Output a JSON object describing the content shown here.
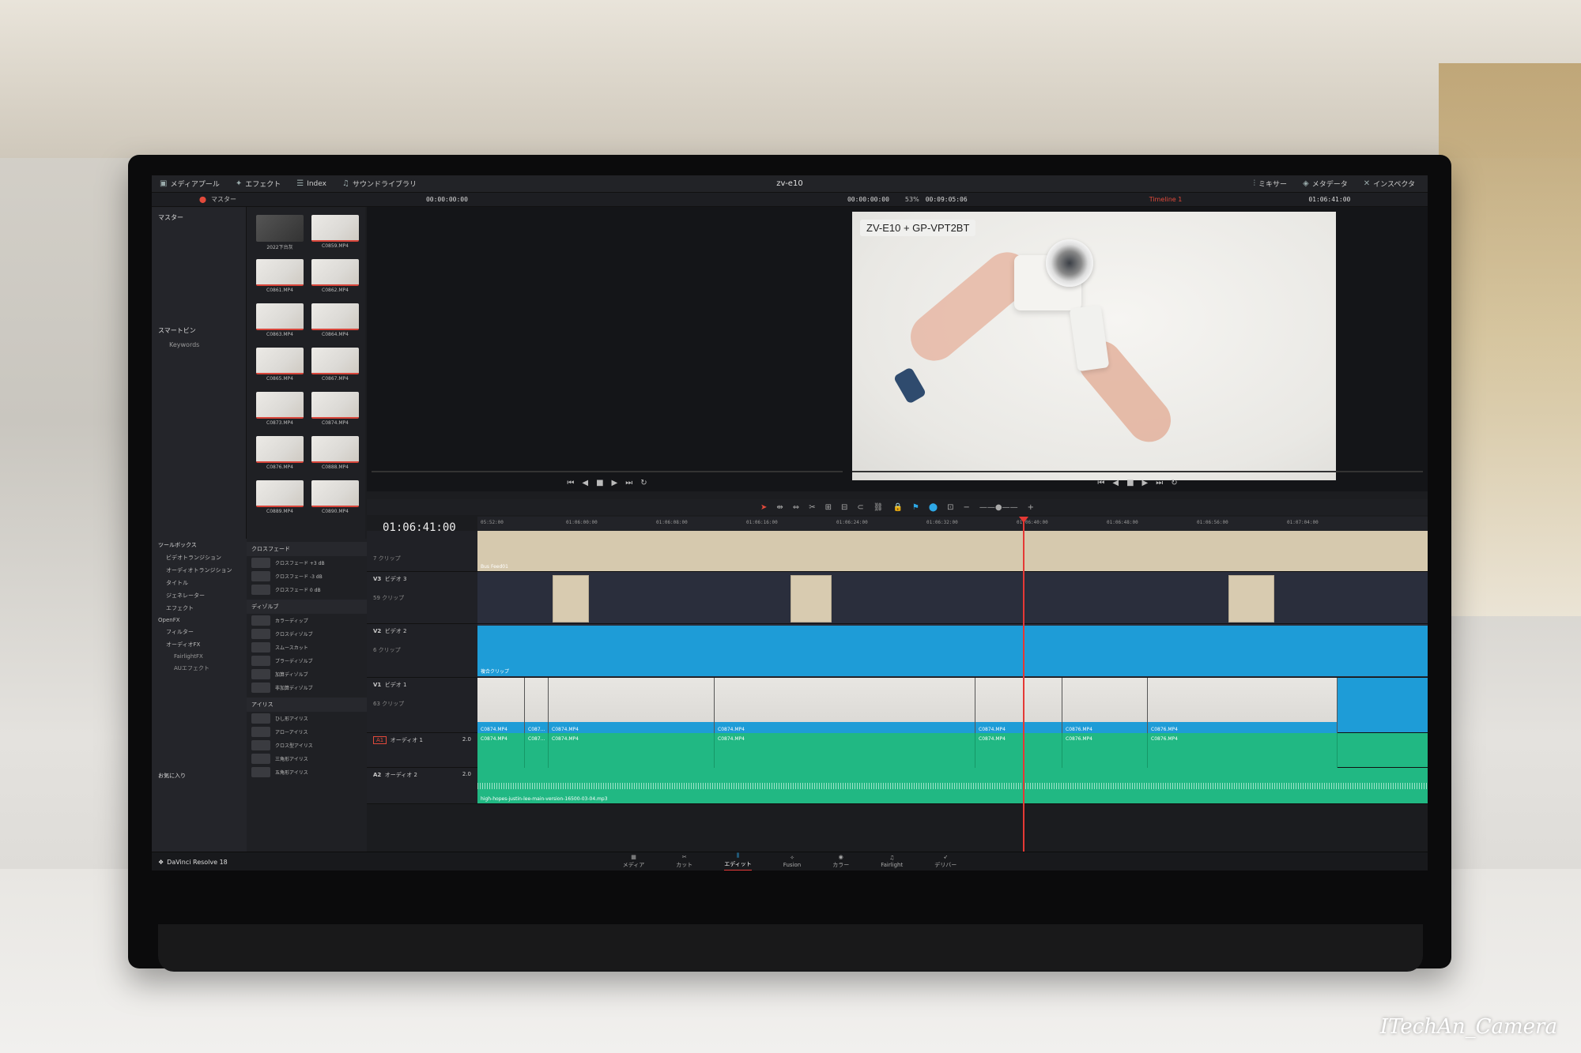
{
  "topbar": {
    "items": [
      {
        "icon": "media-pool-icon",
        "label": "メディアプール"
      },
      {
        "icon": "effects-icon",
        "label": "エフェクト"
      },
      {
        "icon": "index-icon",
        "label": "Index"
      },
      {
        "icon": "sound-library-icon",
        "label": "サウンドライブラリ"
      }
    ],
    "project_title": "zv-e10",
    "right_items": [
      {
        "icon": "mixer-icon",
        "label": "ミキサー"
      },
      {
        "icon": "metadata-icon",
        "label": "メタデータ"
      },
      {
        "icon": "inspector-icon",
        "label": "インスペクタ"
      }
    ]
  },
  "subbar": {
    "bin_label": "マスター",
    "source_tc": "00:00:00:00",
    "source_tc2": "00:00:00:00",
    "zoom": "53%",
    "duration": "00:09:05:06",
    "timeline_name": "Timeline 1",
    "record_tc": "01:06:41:00"
  },
  "pool_tree": {
    "master": "マスター",
    "smart_bin": "スマートビン",
    "keywords": "Keywords"
  },
  "pool_clips": [
    "2022下台灰",
    "C0859.MP4",
    "C0861.MP4",
    "C0862.MP4",
    "C0863.MP4",
    "C0864.MP4",
    "C0865.MP4",
    "C0867.MP4",
    "C0873.MP4",
    "C0874.MP4",
    "C0876.MP4",
    "C0888.MP4",
    "C0889.MP4",
    "C0890.MP4"
  ],
  "record_overlay": "ZV-E10 + GP-VPT2BT",
  "toolbox": {
    "root": "ツールボックス",
    "items": [
      "ビデオトランジション",
      "オーディオトランジション",
      "タイトル",
      "ジェネレーター",
      "エフェクト",
      "OpenFX",
      "フィルター",
      "オーディオFX",
      "FairlightFX",
      "AUエフェクト"
    ],
    "favorites": "お気に入り"
  },
  "effects_list": {
    "crossfade_head": "クロスフェード",
    "crossfades": [
      "クロスフェード +3 dB",
      "クロスフェード -3 dB",
      "クロスフェード 0 dB"
    ],
    "dissolve_head": "ディゾルブ",
    "dissolves": [
      "カラーディップ",
      "クロスディゾルブ",
      "スムースカット",
      "ブラーディゾルブ",
      "加算ディゾルブ",
      "非加算ディゾルブ"
    ],
    "iris_head": "アイリス",
    "irises": [
      "ひし形アイリス",
      "アローアイリス",
      "クロス型アイリス",
      "三角形アイリス",
      "五角形アイリス"
    ]
  },
  "timeline": {
    "timecode": "01:06:41:00",
    "ruler": [
      "05:52:00",
      "01:06:00:00",
      "01:06:08:00",
      "01:06:16:00",
      "01:06:24:00",
      "01:06:32:00",
      "01:06:40:00",
      "01:06:48:00",
      "01:06:56:00",
      "01:07:04:00"
    ],
    "tracks": {
      "v4_sub": "7 クリップ",
      "v3": "V3",
      "v3_name": "ビデオ 3",
      "v3_sub": "59 クリップ",
      "v2": "V2",
      "v2_name": "ビデオ 2",
      "v2_sub": "6 クリップ",
      "v1": "V1",
      "v1_name": "ビデオ 1",
      "v1_sub": "63 クリップ",
      "a1": "A1",
      "a1_name": "オーディオ 1",
      "a1_ch": "2.0",
      "a2": "A2",
      "a2_name": "オーディオ 2",
      "a2_ch": "2.0"
    },
    "v2_clip": "複合クリップ",
    "v4_clip": "Bus Feed01",
    "v1_clips": [
      "C0874.MP4",
      "C087...",
      "C0874.MP4",
      "C0874.MP4",
      "C0874.MP4",
      "C0876.MP4",
      "C0876.MP4"
    ],
    "a1_clips": [
      "C0874.MP4",
      "C087...",
      "C0874.MP4",
      "C0874.MP4",
      "C0874.MP4",
      "C0876.MP4",
      "C0876.MP4"
    ],
    "a2_clip": "high-hopes-justin-lee-main-version-16500-03-04.mp3"
  },
  "bottom_nav": {
    "brand": "DaVinci Resolve 18",
    "pages": [
      "メディア",
      "カット",
      "エディット",
      "Fusion",
      "カラー",
      "Fairlight",
      "デリバー"
    ],
    "active": "エディット"
  },
  "watermark": "ITechAn_Camera"
}
